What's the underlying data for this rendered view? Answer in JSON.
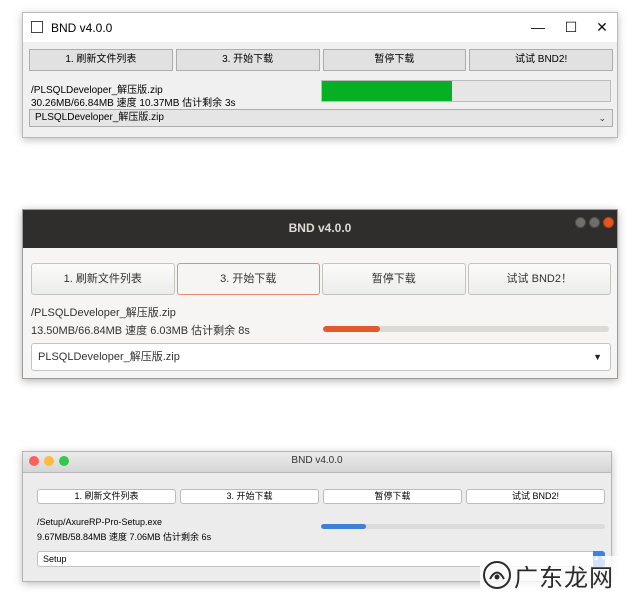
{
  "windows_style": {
    "title": "BND v4.0.0",
    "controls": {
      "minimize": "—",
      "maximize": "☐",
      "close": "✕"
    },
    "buttons": [
      "1. 刷新文件列表",
      "3. 开始下载",
      "暂停下载",
      "试试 BND2!"
    ],
    "file_path": "/PLSQLDeveloper_解压版.zip",
    "status": "30.26MB/66.84MB 速度 10.37MB 估计剩余 3s",
    "progress": 0.45,
    "progress_color": "#06b025",
    "combo_value": "PLSQLDeveloper_解压版.zip"
  },
  "ubuntu_style": {
    "title": "BND v4.0.0",
    "buttons": [
      "1. 刷新文件列表",
      "3. 开始下载",
      "暂停下载",
      "试试 BND2！"
    ],
    "file_path": "/PLSQLDeveloper_解压版.zip",
    "status": "13.50MB/66.84MB 速度 6.03MB 估计剩余 8s",
    "progress": 0.2,
    "progress_color": "#e05a2b",
    "combo_value": "PLSQLDeveloper_解压版.zip"
  },
  "mac_style": {
    "title": "BND v4.0.0",
    "buttons": [
      "1. 刷新文件列表",
      "3. 开始下载",
      "暂停下载",
      "试试 BND2!"
    ],
    "file_path": "/Setup/AxureRP-Pro-Setup.exe",
    "status": "9.67MB/58.84MB 速度 7.06MB 估计剩余 6s",
    "progress": 0.16,
    "progress_color": "#3b82d8",
    "combo_value": "Setup",
    "traffic_light_colors": [
      "#fc605c",
      "#fdbc40",
      "#34c84a"
    ]
  },
  "watermark": {
    "text": "广东龙网"
  }
}
